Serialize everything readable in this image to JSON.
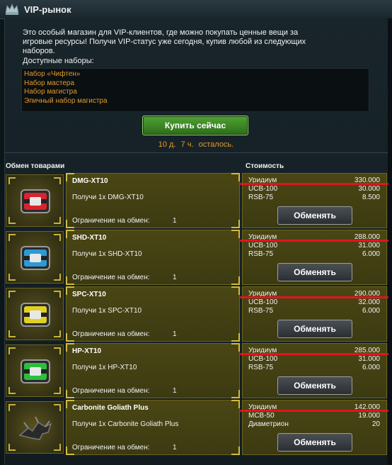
{
  "window": {
    "title": "VIP-рынок"
  },
  "intro": {
    "text_line1": "Это особый магазин для VIP-клиентов, где можно покупать ценные вещи за",
    "text_line2": "игровые ресурсы! Получи VIP-статус уже сегодня, купив любой из следующих",
    "text_line3": "наборов.",
    "available_label": "Доступные наборы:"
  },
  "sets": [
    "Набор «Чифтен»",
    "Набор мастера",
    "Набор магистра",
    "Эпичный набор магистра"
  ],
  "buy_button": "Купить сейчас",
  "time_left": {
    "days": "10 д.",
    "hours": "7 ч.",
    "suffix": "осталось."
  },
  "columns": {
    "items": "Обмен товарами",
    "cost": "Стоимость"
  },
  "limit_label": "Ограничение на обмен:",
  "exchange_label": "Обменять",
  "rows": [
    {
      "name": "DMG-XT10",
      "desc": "Получи 1x DMG-XT10",
      "limit": "1",
      "icon": "red-container-icon",
      "accent": "#d8242e",
      "costs": [
        {
          "currency": "Уридиум",
          "value": "330.000"
        },
        {
          "currency": "UCB-100",
          "value": "30.000"
        },
        {
          "currency": "RSB-75",
          "value": "8.500"
        }
      ]
    },
    {
      "name": "SHD-XT10",
      "desc": "Получи 1x SHD-XT10",
      "limit": "1",
      "icon": "blue-container-icon",
      "accent": "#2a9ad8",
      "costs": [
        {
          "currency": "Уридиум",
          "value": "288.000"
        },
        {
          "currency": "UCB-100",
          "value": "31.000"
        },
        {
          "currency": "RSB-75",
          "value": "6.000"
        }
      ]
    },
    {
      "name": "SPC-XT10",
      "desc": "Получи 1x SPC-XT10",
      "limit": "1",
      "icon": "yellow-container-icon",
      "accent": "#e2d01e",
      "costs": [
        {
          "currency": "Уридиум",
          "value": "290.000"
        },
        {
          "currency": "UCB-100",
          "value": "32.000"
        },
        {
          "currency": "RSB-75",
          "value": "6.000"
        }
      ]
    },
    {
      "name": "HP-XT10",
      "desc": "Получи 1x HP-XT10",
      "limit": "1",
      "icon": "green-container-icon",
      "accent": "#2bbf3e",
      "costs": [
        {
          "currency": "Уридиум",
          "value": "285.000"
        },
        {
          "currency": "UCB-100",
          "value": "31.000"
        },
        {
          "currency": "RSB-75",
          "value": "6.000"
        }
      ]
    },
    {
      "name": "Carbonite Goliath Plus",
      "desc": "Получи 1x Carbonite Goliath Plus",
      "limit": "1",
      "icon": "ship-icon",
      "accent": "#3a3a3a",
      "costs": [
        {
          "currency": "Уридиум",
          "value": "142.000"
        },
        {
          "currency": "MCB-50",
          "value": "19.000"
        },
        {
          "currency": "Диаметрион",
          "value": "20"
        }
      ]
    }
  ]
}
